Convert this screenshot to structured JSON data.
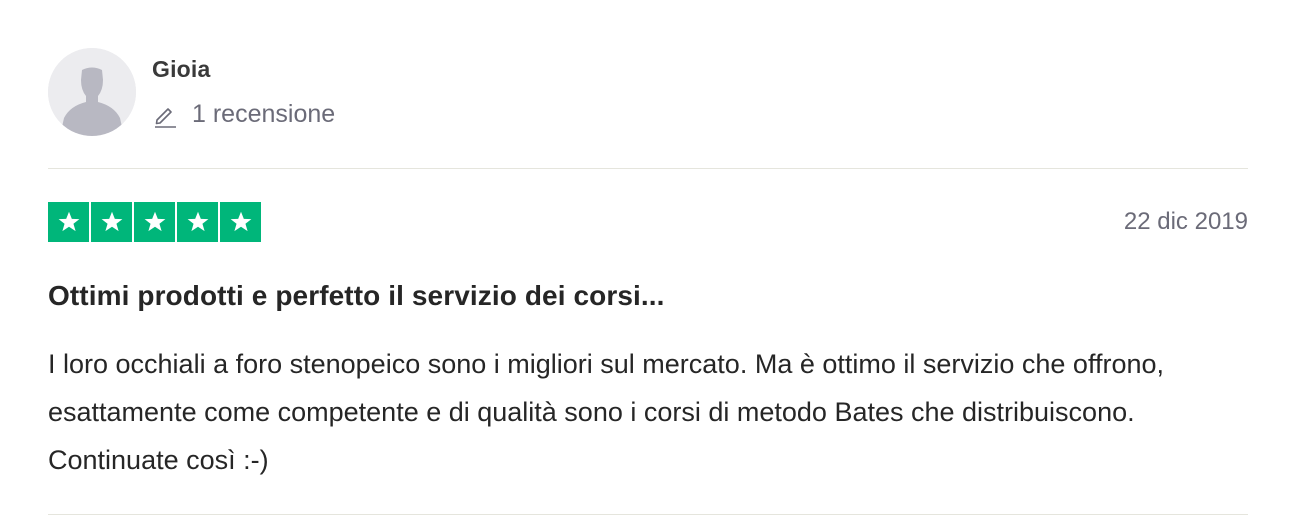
{
  "consumer": {
    "name": "Gioia",
    "reviews_count": "1 recensione",
    "avatar_icon": "default-user-avatar-icon",
    "count_icon": "pencil-icon"
  },
  "review": {
    "rating": 5,
    "rating_max": 5,
    "star_color": "#00b67a",
    "date": "22 dic 2019",
    "title": "Ottimi prodotti e perfetto il servizio dei corsi...",
    "text": "I loro occhiali a foro stenopeico sono i migliori sul mercato. Ma è ottimo il servizio che offrono, esattamente come competente e di qualità sono i corsi di metodo Bates che distribuiscono. Continuate così :-)"
  }
}
